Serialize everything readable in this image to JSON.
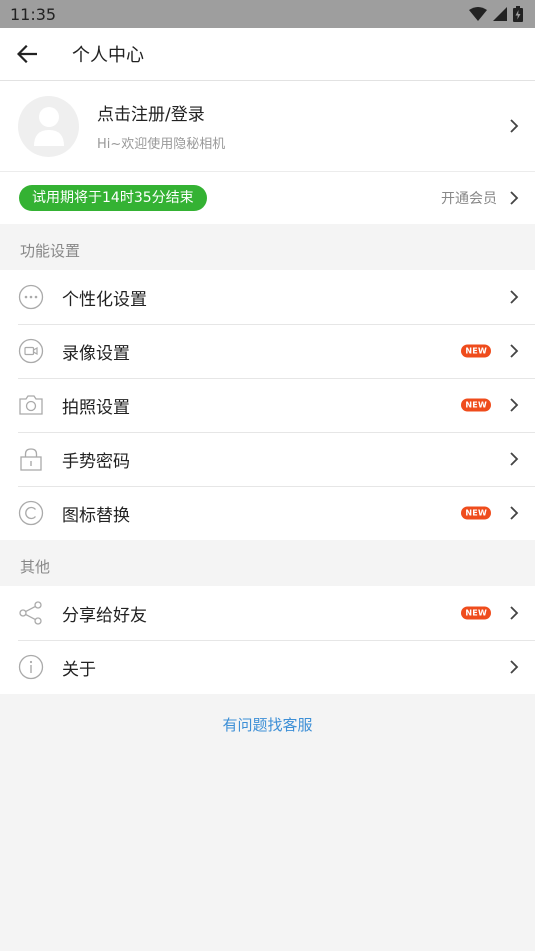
{
  "status_bar": {
    "time": "11:35"
  },
  "app_bar": {
    "title": "个人中心"
  },
  "profile": {
    "title": "点击注册/登录",
    "subtitle": "Hi~欢迎使用隐秘相机"
  },
  "vip": {
    "trial_text": "试用期将于14时35分结束",
    "open_label": "开通会员",
    "accent": "#34b233"
  },
  "sections": {
    "features_title": "功能设置",
    "features": [
      {
        "label": "个性化设置",
        "icon": "more-dots-icon",
        "new": ""
      },
      {
        "label": "录像设置",
        "icon": "video-camera-icon",
        "new": "NEW"
      },
      {
        "label": "拍照设置",
        "icon": "camera-icon",
        "new": "NEW"
      },
      {
        "label": "手势密码",
        "icon": "lock-icon",
        "new": ""
      },
      {
        "label": "图标替换",
        "icon": "copyright-icon",
        "new": "NEW"
      }
    ],
    "other_title": "其他",
    "other": [
      {
        "label": "分享给好友",
        "icon": "share-icon",
        "new": "NEW"
      },
      {
        "label": "关于",
        "icon": "info-icon",
        "new": ""
      }
    ]
  },
  "footer": {
    "service_link": "有问题找客服"
  },
  "colors": {
    "new_badge": "#ef4c1c",
    "link": "#3d8fd6"
  }
}
